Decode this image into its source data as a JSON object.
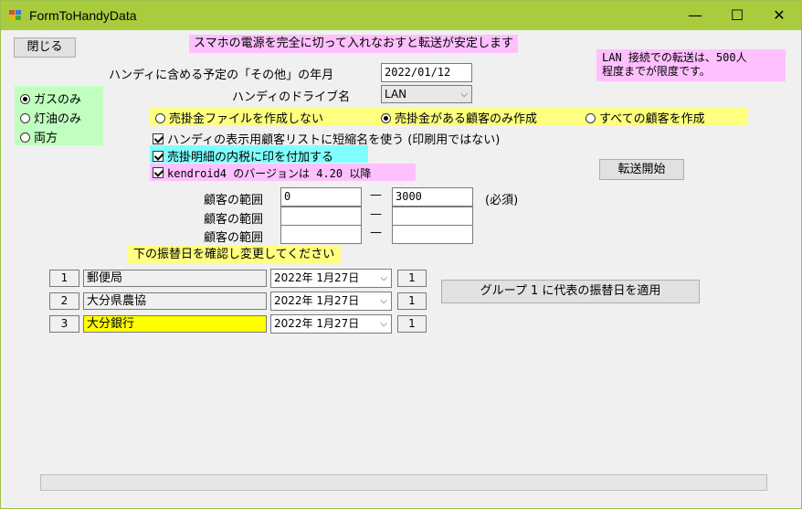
{
  "window": {
    "title": "FormToHandyData",
    "minimize": "—",
    "maximize": "☐",
    "close": "✕"
  },
  "close_button": "閉じる",
  "notices": {
    "power": "スマホの電源を完全に切って入れなおすと転送が安定します",
    "lan_line1": "LAN 接続での転送は、500人",
    "lan_line2": "程度までが限度です。"
  },
  "fields": {
    "year_month_label": "ハンディに含める予定の「その他」の年月",
    "year_month_value": "2022/01/12",
    "drive_label": "ハンディのドライブ名",
    "drive_value": "LAN"
  },
  "fuel": {
    "options": [
      "ガスのみ",
      "灯油のみ",
      "両方"
    ],
    "selected": "ガスのみ"
  },
  "receivable": {
    "options": [
      "売掛金ファイルを作成しない",
      "売掛金がある顧客のみ作成",
      "すべての顧客を作成"
    ],
    "selected": "売掛金がある顧客のみ作成"
  },
  "checkboxes": {
    "short_name": "ハンディの表示用顧客リストに短縮名を使う (印刷用ではない)",
    "tax_mark": "売掛明細の内税に印を付加する",
    "kendroid": "kendroid4 のバージョンは 4.20 以降"
  },
  "transfer_button": "転送開始",
  "ranges": {
    "label": "顧客の範囲",
    "separator": "—",
    "required": "(必須)",
    "rows": [
      {
        "from": "0",
        "to": "3000"
      },
      {
        "from": "",
        "to": ""
      },
      {
        "from": "",
        "to": ""
      }
    ]
  },
  "transfer_date_notice": "下の振替日を確認し変更してください",
  "banks": [
    {
      "no": "1",
      "name": "郵便局",
      "date": "2022年  1月27日",
      "group": "1",
      "highlight": false
    },
    {
      "no": "2",
      "name": "大分県農協",
      "date": "2022年  1月27日",
      "group": "1",
      "highlight": false
    },
    {
      "no": "3",
      "name": "大分銀行",
      "date": "2022年  1月27日",
      "group": "1",
      "highlight": true
    }
  ],
  "apply_group_button": "グループ 1 に代表の振替日を適用",
  "colors": {
    "titlebar": "#a9cc3f",
    "pink_label": "#ffc0ff",
    "yellow_label": "#ffff80",
    "green_panel": "#c0ffc0",
    "cyan_label": "#80ffff",
    "highlight_field": "#ffff00"
  },
  "icons": [
    "app-icon",
    "chevron-down-icon"
  ]
}
